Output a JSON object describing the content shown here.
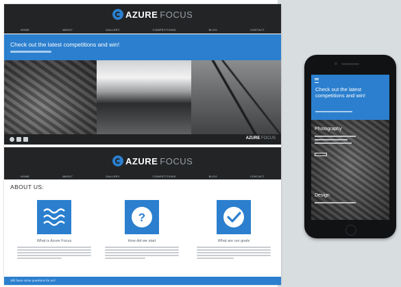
{
  "brand": {
    "word1": "AZURE",
    "word2": "FOCUS"
  },
  "nav": {
    "items": [
      "HOME",
      "ABOUT",
      "GALLERY",
      "COMPETITIONS",
      "BLOG",
      "CONTACT"
    ]
  },
  "banner": {
    "headline": "Check out the latest competitions and win!"
  },
  "about": {
    "title": "ABOUT US:"
  },
  "features": [
    {
      "caption": "What is Azure Focus",
      "icon": "waves-icon"
    },
    {
      "caption": "How did we start",
      "icon": "question-mark-icon"
    },
    {
      "caption": "What are our goals",
      "icon": "checkmark-icon"
    }
  ],
  "footer": {
    "text": "Still have some questions for us?"
  },
  "mobile": {
    "headline": "Check out the latest competitions and win!",
    "label1": "Photography",
    "label2": "Design"
  },
  "colors": {
    "accent": "#2b7fce",
    "header_bg": "#222426",
    "scene_bg": "#d8dde0"
  }
}
